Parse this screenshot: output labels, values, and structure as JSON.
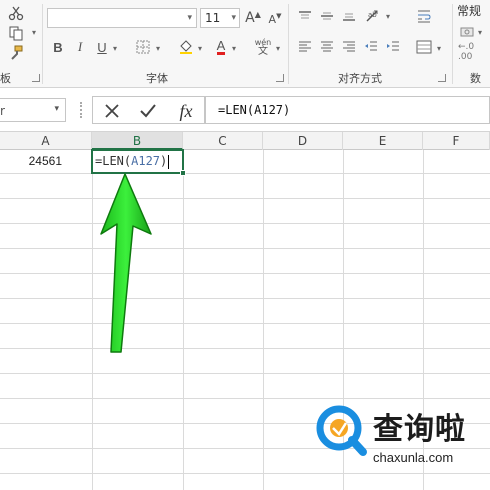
{
  "ribbon": {
    "clipboard_group_partial": "板",
    "font_group_label": "字体",
    "alignment_group_label": "对齐方式",
    "number_group_partial": "数字",
    "font_size": "11",
    "bold_label": "B",
    "italic_label": "I",
    "underline_label": "U",
    "grow_font_label": "A",
    "shrink_font_label": "A",
    "font_color_label": "A",
    "phonetic_label": "wén",
    "number_format": "常规"
  },
  "formula_bar": {
    "name_box_fragment": "r",
    "cancel_icon": "close-icon",
    "enter_icon": "check-icon",
    "function_label": "fx",
    "formula": "=LEN(A127)"
  },
  "sheet": {
    "columns": [
      "A",
      "B",
      "C",
      "D",
      "E",
      "F"
    ],
    "selected_column": "B",
    "cell_a_value": "24561",
    "cell_b_prefix": "=LEN(",
    "cell_b_ref": "A127",
    "cell_b_suffix": ")"
  },
  "annotation": {
    "arrow_color": "#22dd22",
    "arrow_direction": "up"
  },
  "watermark": {
    "brand": "查询啦",
    "url": "chaxunla.com",
    "logo_colors": [
      "#1a8ee0",
      "#f5a623"
    ]
  },
  "colors": {
    "accent": "#217346",
    "ribbon_bg": "#f7f7f7"
  }
}
